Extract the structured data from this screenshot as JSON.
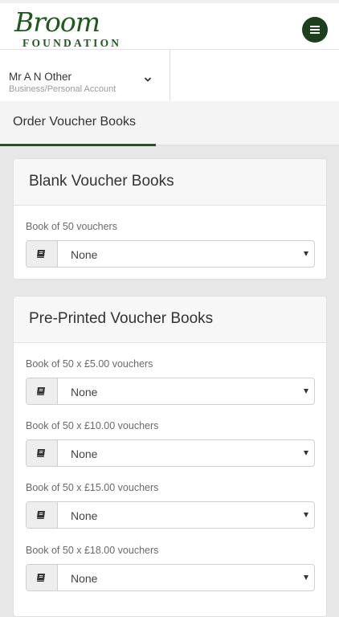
{
  "header": {
    "logo_script": "Broom",
    "logo_subtitle": "FOUNDATION",
    "menu_icon": "hamburger-icon",
    "brand_color": "#1e5a1e"
  },
  "account": {
    "name": "Mr A N Other",
    "type": "Business/Personal Account",
    "icon": "chevron-down-icon"
  },
  "tabs": [
    {
      "label": "Order Voucher Books",
      "active": true
    }
  ],
  "sections": [
    {
      "title": "Blank Voucher Books",
      "fields": [
        {
          "label": "Book of 50 vouchers",
          "value": "None",
          "icon": "book-icon"
        }
      ]
    },
    {
      "title": "Pre-Printed Voucher Books",
      "fields": [
        {
          "label": "Book of 50 x £5.00 vouchers",
          "value": "None",
          "icon": "book-icon"
        },
        {
          "label": "Book of 50 x £10.00 vouchers",
          "value": "None",
          "icon": "book-icon"
        },
        {
          "label": "Book of 50 x £15.00 vouchers",
          "value": "None",
          "icon": "book-icon"
        },
        {
          "label": "Book of 50 x £18.00 vouchers",
          "value": "None",
          "icon": "book-icon"
        }
      ]
    }
  ]
}
